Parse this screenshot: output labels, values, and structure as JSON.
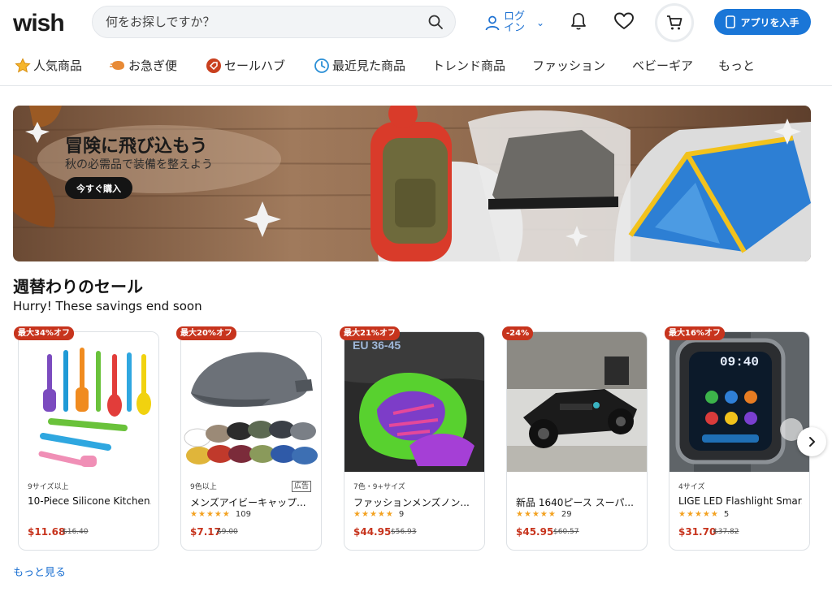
{
  "header": {
    "logo": "wish",
    "search_placeholder": "何をお探しですか？",
    "login_label": "ログイン",
    "app_button_label": "アプリを入手"
  },
  "nav": {
    "items": [
      {
        "label": "人気商品",
        "icon": "star-icon"
      },
      {
        "label": "お急ぎ便",
        "icon": "fast-delivery-icon"
      },
      {
        "label": "セールハブ",
        "icon": "sale-tag-icon"
      },
      {
        "label": "最近見た商品",
        "icon": "clock-icon"
      },
      {
        "label": "トレンド商品"
      },
      {
        "label": "ファッション"
      },
      {
        "label": "ベビーギア"
      },
      {
        "label": "もっと"
      }
    ]
  },
  "banner": {
    "title": "冒険に飛び込もう",
    "subtitle": "秋の必需品で装備を整えよう",
    "button_label": "今すぐ購入"
  },
  "section": {
    "title": "週替わりのセール",
    "subtitle": "Hurry! These savings end soon",
    "more_label": "もっと見る"
  },
  "products": [
    {
      "badge": "最大34%オフ",
      "meta": "9サイズ以上",
      "title": "10-Piece Silicone Kitchen...",
      "stars": 0,
      "reviews": "",
      "price": "$11.68",
      "old_price": "$16.40",
      "ad": ""
    },
    {
      "badge": "最大20%オフ",
      "meta": "9色以上",
      "title": "メンズアイビーキャップ...",
      "stars": 4.5,
      "reviews": "109",
      "price": "$7.17",
      "old_price": "$9.00",
      "ad": "広告"
    },
    {
      "badge": "最大21%オフ",
      "meta": "7色・9+サイズ",
      "title": "ファッションメンズノン...",
      "stars": 4.5,
      "reviews": "9",
      "price": "$44.95",
      "old_price": "$56.93",
      "ad": "",
      "image_text": "EU 36-45"
    },
    {
      "badge": "-24%",
      "meta": "",
      "title": "新品 1640ピース スーパ...",
      "stars": 4.5,
      "reviews": "29",
      "price": "$45.95",
      "old_price": "$60.57",
      "ad": ""
    },
    {
      "badge": "最大16%オフ",
      "meta": "4サイズ",
      "title": "LIGE LED Flashlight Smar...",
      "stars": 4.5,
      "reviews": "5",
      "price": "$31.70",
      "old_price": "$37.82",
      "ad": "",
      "image_text": "09:40"
    }
  ],
  "colors": {
    "brand_blue": "#1a76d7",
    "sale_red": "#c7341d",
    "star_orange": "#f3a221"
  }
}
